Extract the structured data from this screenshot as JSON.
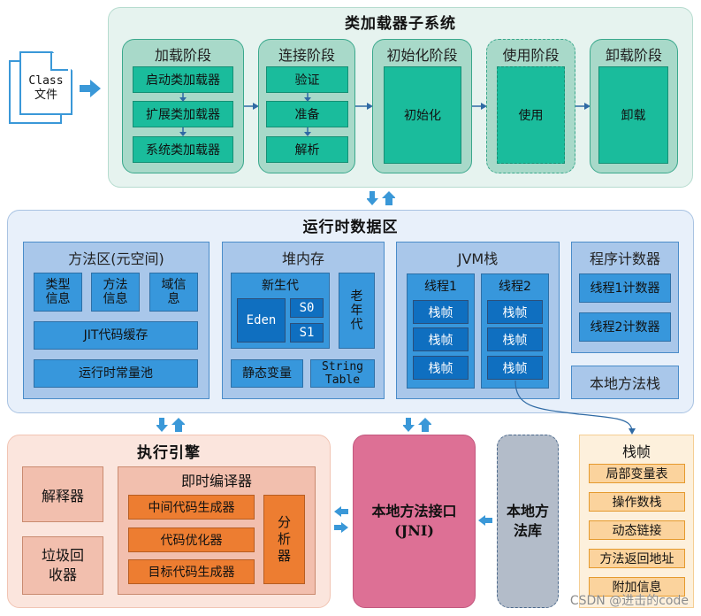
{
  "class_file": {
    "line1": "Class",
    "line2": "文件"
  },
  "class_loader_subsystem": {
    "title": "类加载器子系统",
    "stages": [
      {
        "title": "加载阶段",
        "items": [
          "启动类加载器",
          "扩展类加载器",
          "系统类加载器"
        ]
      },
      {
        "title": "连接阶段",
        "items": [
          "验证",
          "准备",
          "解析"
        ]
      },
      {
        "title": "初始化阶段",
        "items": [
          "初始化"
        ]
      },
      {
        "title": "使用阶段",
        "items": [
          "使用"
        ]
      },
      {
        "title": "卸载阶段",
        "items": [
          "卸载"
        ]
      }
    ]
  },
  "runtime_data_area": {
    "title": "运行时数据区",
    "method_area": {
      "title": "方法区(元空间)",
      "type_info": "类型\n信息",
      "method_info": "方法\n信息",
      "field_info": "域信\n息",
      "jit_cache": "JIT代码缓存",
      "runtime_constant_pool": "运行时常量池"
    },
    "heap": {
      "title": "堆内存",
      "young_gen": "新生代",
      "eden": "Eden",
      "s0": "S0",
      "s1": "S1",
      "old_gen": "老\n年\n代",
      "static_vars": "静态变量",
      "string_table": "String\nTable"
    },
    "jvm_stack": {
      "title": "JVM栈",
      "threads": [
        {
          "title": "线程1",
          "frames": [
            "栈帧",
            "栈帧",
            "栈帧"
          ]
        },
        {
          "title": "线程2",
          "frames": [
            "栈帧",
            "栈帧",
            "栈帧"
          ]
        }
      ]
    },
    "pc_register": {
      "title": "程序计数器",
      "items": [
        "线程1计数器",
        "线程2计数器"
      ]
    },
    "native_method_stack": "本地方法栈"
  },
  "execution_engine": {
    "title": "执行引擎",
    "interpreter": "解释器",
    "gc": "垃圾回\n收器",
    "jit": {
      "title": "即时编译器",
      "items": [
        "中间代码生成器",
        "代码优化器",
        "目标代码生成器"
      ],
      "analyzer": "分\n析\n器"
    }
  },
  "jni": {
    "line1": "本地方法接口",
    "line2": "(JNI)"
  },
  "native_library": {
    "text": "本地方\n法库"
  },
  "stack_frame": {
    "title": "栈帧",
    "items": [
      "局部变量表",
      "操作数栈",
      "动态链接",
      "方法返回地址",
      "附加信息"
    ]
  },
  "watermark": "CSDN @进击的code",
  "colors": {
    "loader_bg": "#e6f3ef",
    "stage_bg": "#a8d9c9",
    "teal": "#1abc9c",
    "runtime_bg": "#e8f0fa",
    "panel_blue": "#a9c7ea",
    "box_blue": "#3797dc",
    "dark_blue": "#0f6fc0",
    "engine_bg": "#fbe5dd",
    "orange": "#ed7d31",
    "jni_pink": "#dd7095",
    "native_gray": "#b3bcc9",
    "frame_bg": "#fdf0dc",
    "arrow_blue": "#3a98d8"
  }
}
